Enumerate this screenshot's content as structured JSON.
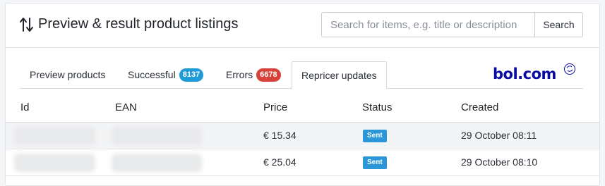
{
  "header": {
    "title": "Preview & result product listings",
    "icon": "sort-arrows-icon"
  },
  "search": {
    "placeholder": "Search for items, e.g. title or description",
    "value": "",
    "button_label": "Search"
  },
  "tabs": [
    {
      "label": "Preview products",
      "active": false
    },
    {
      "label": "Successful",
      "badge": "8137",
      "badge_color": "#1e9ad6",
      "active": false
    },
    {
      "label": "Errors",
      "badge": "6678",
      "badge_color": "#d8403a",
      "active": false
    },
    {
      "label": "Repricer updates",
      "active": true
    }
  ],
  "brand": {
    "logo_text": "bol.com",
    "logo_color": "#0a0aa3"
  },
  "table": {
    "columns": [
      "Id",
      "EAN",
      "Price",
      "Status",
      "Created"
    ],
    "rows": [
      {
        "id": "",
        "ean": "",
        "price": "€ 15.34",
        "status": "Sent",
        "created": "29 October 08:11"
      },
      {
        "id": "",
        "ean": "",
        "price": "€ 25.04",
        "status": "Sent",
        "created": "29 October 08:10"
      }
    ]
  },
  "colors": {
    "status_sent": "#2c97d8"
  }
}
